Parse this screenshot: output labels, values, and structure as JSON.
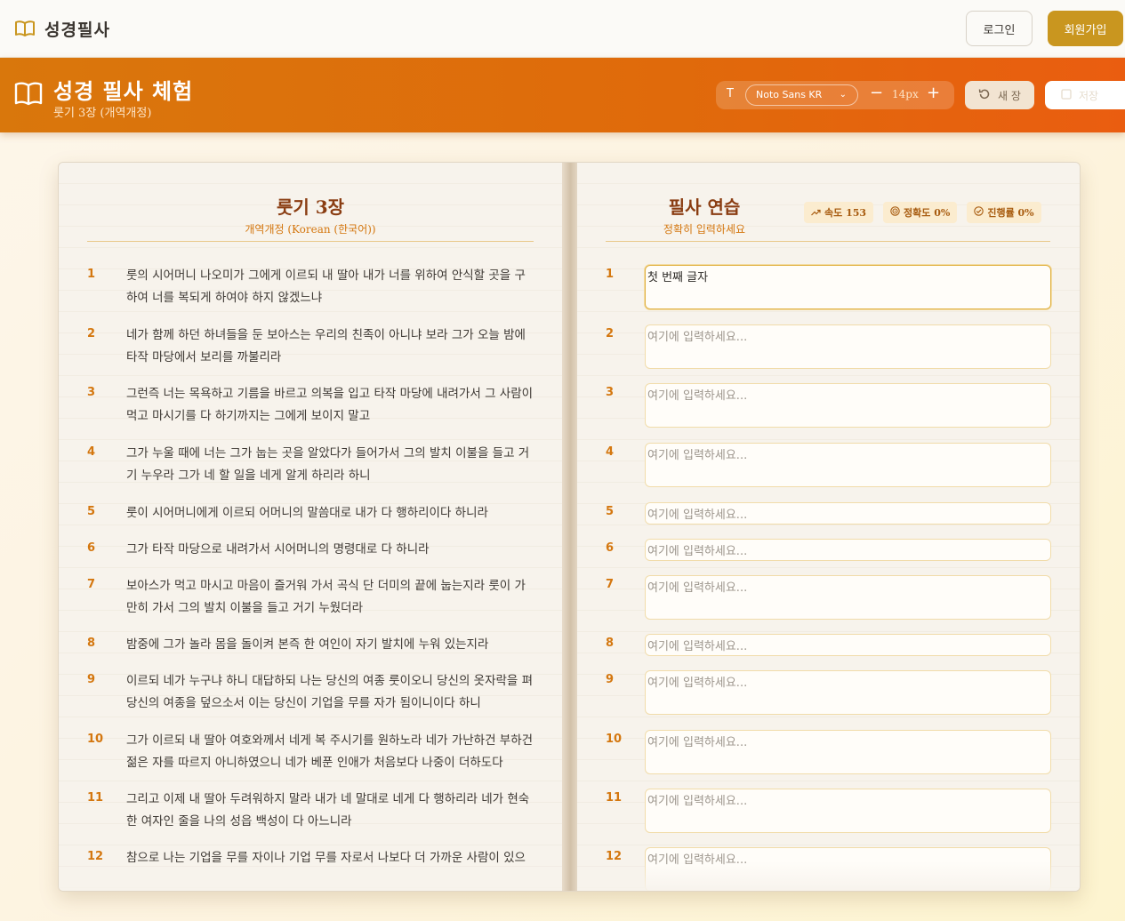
{
  "nav": {
    "brand": "성경필사",
    "login_label": "로그인",
    "signup_label": "회원가입"
  },
  "header": {
    "title": "성경 필사 체험",
    "subtitle": "룻기 3장 (개역개정)",
    "font_icon": "T",
    "font_name": "Noto Sans KR",
    "font_size": "14px",
    "new_page_label": "새 장",
    "save_label": "저장"
  },
  "left_page": {
    "title": "룻기 3장",
    "subtitle": "개역개정 (Korean (한국어))",
    "verses": [
      {
        "num": "1",
        "text": "룻의 시어머니 나오미가 그에게 이르되 내 딸아 내가 너를 위하여 안식할 곳을 구하여 너를 복되게 하여야 하지 않겠느냐"
      },
      {
        "num": "2",
        "text": "네가 함께 하던 하녀들을 둔 보아스는 우리의 친족이 아니냐 보라 그가 오늘 밤에 타작 마당에서 보리를 까불리라"
      },
      {
        "num": "3",
        "text": "그런즉 너는 목욕하고 기름을 바르고 의복을 입고 타작 마당에 내려가서 그 사람이 먹고 마시기를 다 하기까지는 그에게 보이지 말고"
      },
      {
        "num": "4",
        "text": "그가 누울 때에 너는 그가 눕는 곳을 알았다가 들어가서 그의 발치 이불을 들고 거기 누우라 그가 네 할 일을 네게 알게 하리라 하니"
      },
      {
        "num": "5",
        "text": "룻이 시어머니에게 이르되 어머니의 말씀대로 내가 다 행하리이다 하니라"
      },
      {
        "num": "6",
        "text": "그가 타작 마당으로 내려가서 시어머니의 명령대로 다 하니라"
      },
      {
        "num": "7",
        "text": "보아스가 먹고 마시고 마음이 즐거워 가서 곡식 단 더미의 끝에 눕는지라 룻이 가만히 가서 그의 발치 이불을 들고 거기 누웠더라"
      },
      {
        "num": "8",
        "text": "밤중에 그가 놀라 몸을 돌이켜 본즉 한 여인이 자기 발치에 누워 있는지라"
      },
      {
        "num": "9",
        "text": "이르되 네가 누구냐 하니 대답하되 나는 당신의 여종 룻이오니 당신의 옷자락을 펴 당신의 여종을 덮으소서 이는 당신이 기업을 무를 자가 됨이니이다 하니"
      },
      {
        "num": "10",
        "text": "그가 이르되 내 딸아 여호와께서 네게 복 주시기를 원하노라 네가 가난하건 부하건 젊은 자를 따르지 아니하였으니 네가 베푼 인애가 처음보다 나중이 더하도다"
      },
      {
        "num": "11",
        "text": "그리고 이제 내 딸아 두려워하지 말라 내가 네 말대로 네게 다 행하리라 네가 현숙한 여자인 줄을 나의 성읍 백성이 다 아느니라"
      },
      {
        "num": "12",
        "text": "참으로 나는 기업을 무를 자이나 기업 무를 자로서 나보다 더 가까운 사람이 있으"
      }
    ]
  },
  "right_page": {
    "title": "필사 연습",
    "subtitle": "정확히 입력하세요",
    "stats": {
      "speed": "속도 153",
      "accuracy": "정확도 0%",
      "progress": "진행률 0%"
    },
    "placeholder": "여기에 입력하세요...",
    "inputs": [
      {
        "num": "1",
        "value": "첫 번째 글자"
      },
      {
        "num": "2",
        "value": ""
      },
      {
        "num": "3",
        "value": ""
      },
      {
        "num": "4",
        "value": ""
      },
      {
        "num": "5",
        "value": ""
      },
      {
        "num": "6",
        "value": ""
      },
      {
        "num": "7",
        "value": ""
      },
      {
        "num": "8",
        "value": ""
      },
      {
        "num": "9",
        "value": ""
      },
      {
        "num": "10",
        "value": ""
      },
      {
        "num": "11",
        "value": ""
      },
      {
        "num": "12",
        "value": ""
      }
    ]
  },
  "colors": {
    "accent": "#d9770c",
    "brand_gold": "#c9961f",
    "verse_number": "#d4770f",
    "title_brown": "#8a3d12"
  }
}
